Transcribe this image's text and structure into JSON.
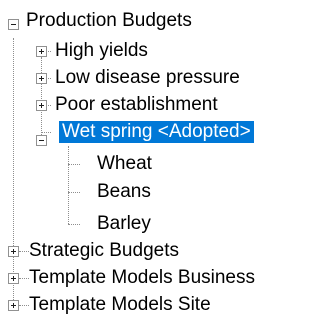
{
  "tree": {
    "root": {
      "label": "Production Budgets",
      "expanded": true
    },
    "children": [
      {
        "label": "High yields",
        "expanded": false
      },
      {
        "label": "Low disease pressure",
        "expanded": false
      },
      {
        "label": "Poor establishment",
        "expanded": false
      },
      {
        "label": "Wet spring <Adopted>",
        "expanded": true,
        "selected": true,
        "children": [
          {
            "label": "Wheat"
          },
          {
            "label": "Beans"
          },
          {
            "label": "Barley"
          }
        ]
      }
    ],
    "siblings": [
      {
        "label": "Strategic Budgets",
        "expanded": false
      },
      {
        "label": "Template Models Business",
        "expanded": false
      },
      {
        "label": "Template Models Site",
        "expanded": false
      }
    ]
  },
  "colors": {
    "selection": "#0078d7",
    "lines": "#8e8e8e"
  }
}
